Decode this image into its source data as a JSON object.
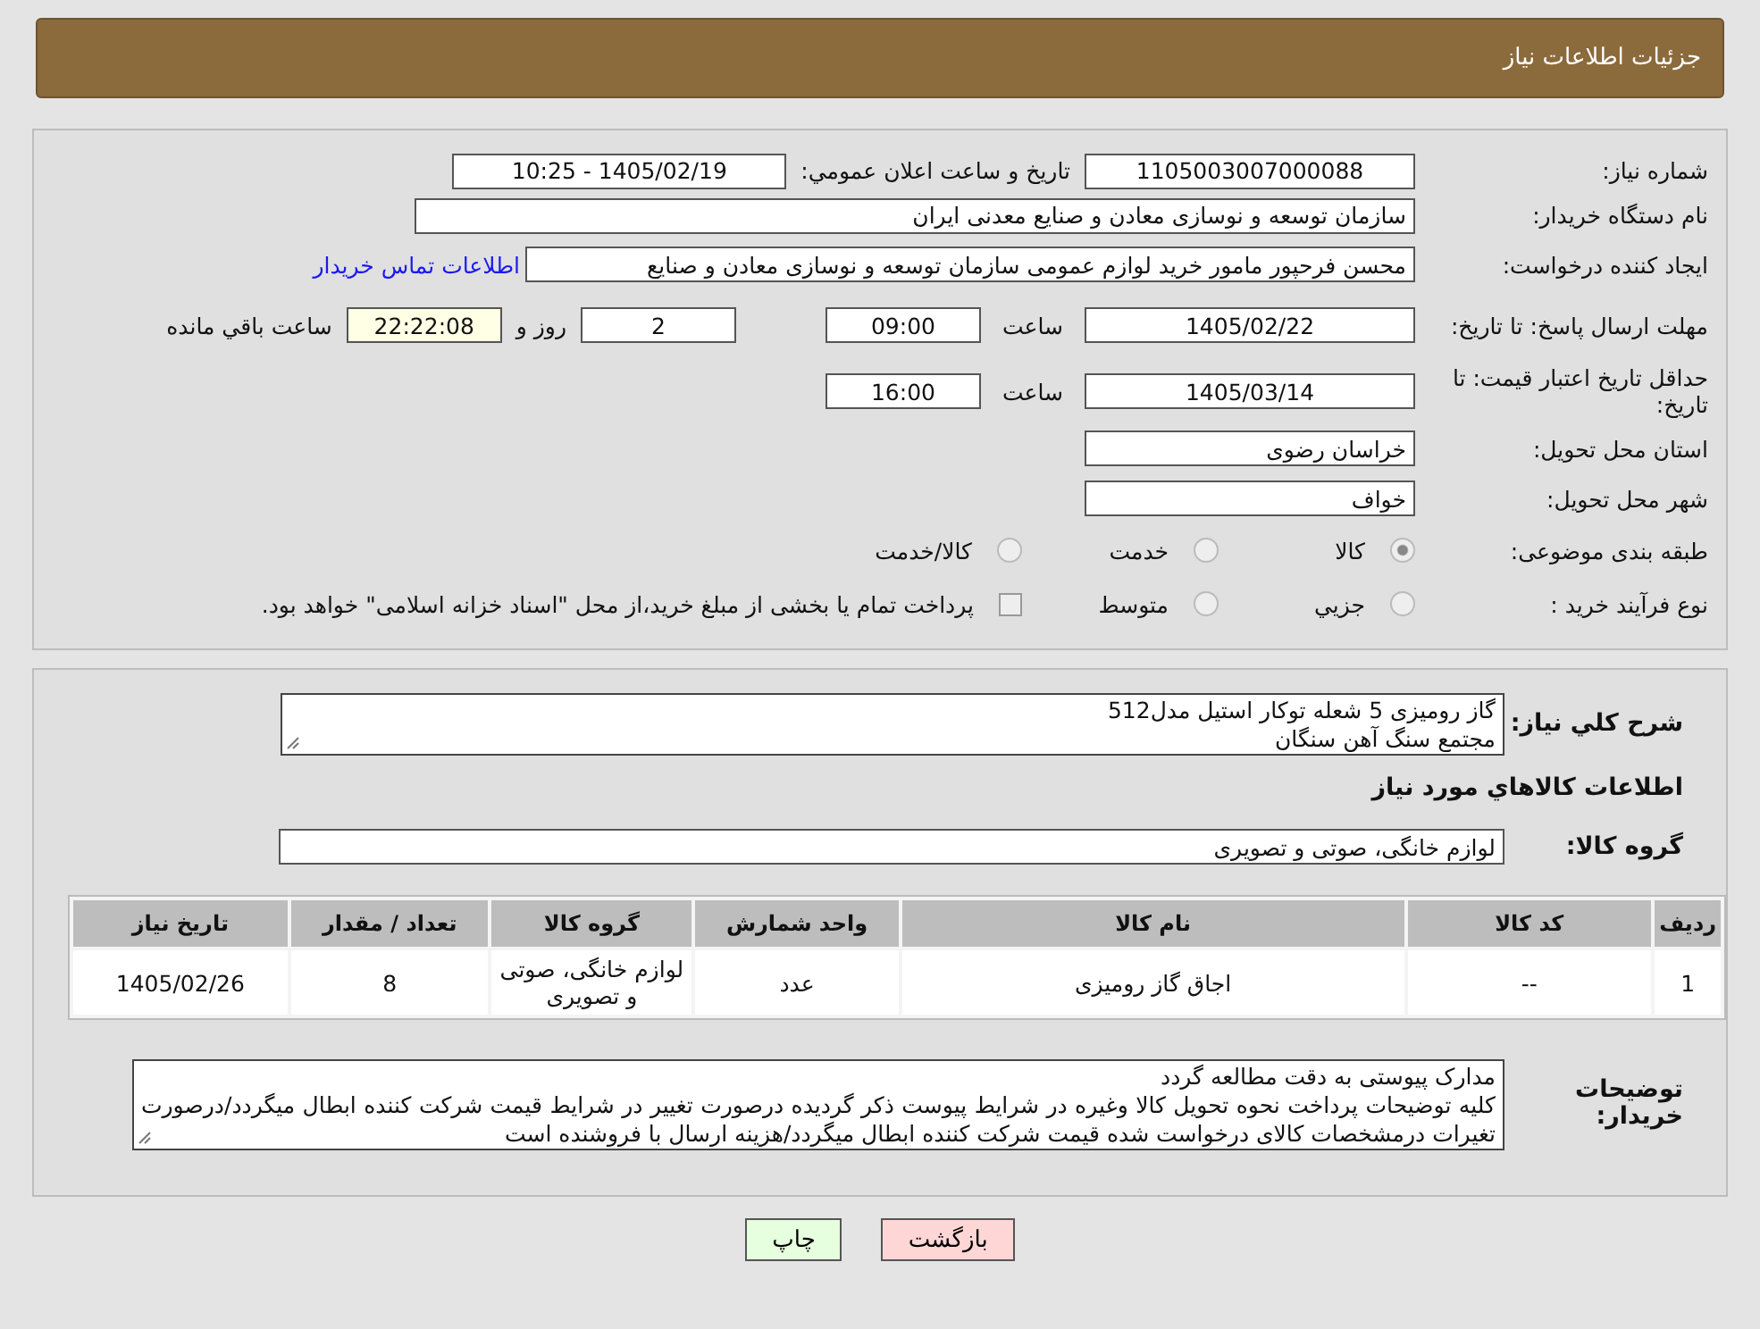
{
  "title": "جزئیات اطلاعات نیاز",
  "need_number": {
    "label": "شماره نیاز:",
    "value": "1105003007000088"
  },
  "announce": {
    "label": "تاريخ و ساعت اعلان عمومي:",
    "value": "1405/02/19 - 10:25"
  },
  "buyer_org": {
    "label": "نام دستگاه خريدار:",
    "value": "سازمان توسعه و نوسازی معادن و صنایع معدنی ایران"
  },
  "creator": {
    "label": "ايجاد کننده درخواست:",
    "value": "محسن فرحپور مامور خرید لوازم عمومی سازمان توسعه و نوسازی معادن و صنایع",
    "link": "اطلاعات تماس خريدار"
  },
  "deadline": {
    "label": "مهلت ارسال پاسخ: تا تاریخ:",
    "date": "1405/02/22",
    "time_label": "ساعت",
    "time": "09:00",
    "days": "2",
    "days_label": "روز و",
    "remaining": "22:22:08",
    "remaining_label": "ساعت باقي مانده"
  },
  "validity": {
    "label": "حداقل تاریخ اعتبار قیمت: تا تاریخ:",
    "date": "1405/03/14",
    "time_label": "ساعت",
    "time": "16:00"
  },
  "province": {
    "label": "استان محل تحویل:",
    "value": "خراسان رضوی"
  },
  "city": {
    "label": "شهر محل تحویل:",
    "value": "خواف"
  },
  "category": {
    "label": "طبقه بندی موضوعی:",
    "options": [
      {
        "label": "کالا",
        "selected": true
      },
      {
        "label": "خدمت",
        "selected": false
      },
      {
        "label": "کالا/خدمت",
        "selected": false
      }
    ]
  },
  "purchase_type": {
    "label": "نوع فرآیند خرید :",
    "options": [
      {
        "kind": "radio",
        "label": "جزيي",
        "selected": false
      },
      {
        "kind": "radio",
        "label": "متوسط",
        "selected": false
      },
      {
        "kind": "checkbox",
        "label": "پرداخت تمام یا بخشی از مبلغ خرید،از محل \"اسناد خزانه اسلامی\" خواهد بود.",
        "selected": false
      }
    ]
  },
  "description": {
    "label": "شرح کلي نياز:",
    "lines": [
      "گاز رومیزی 5 شعله توکار  استیل مدل512",
      "مجتمع سنگ آهن سنگان"
    ]
  },
  "goods_heading": "اطلاعات کالاهاي مورد نياز",
  "goods_group": {
    "label": "گروه کالا:",
    "value": "لوازم خانگی، صوتی و تصویری"
  },
  "table": {
    "columns": [
      "رديف",
      "کد کالا",
      "نام کالا",
      "واحد شمارش",
      "گروه کالا",
      "تعداد / مقدار",
      "تاريخ نياز"
    ],
    "rows": [
      [
        "1",
        "--",
        "اجاق گاز رومیزی",
        "عدد",
        "لوازم خانگی، صوتی و تصویری",
        "8",
        "1405/02/26"
      ]
    ]
  },
  "buyer_notes": {
    "label": "توضیحات خریدار:",
    "lines": [
      "مدارک پیوستی به دقت مطالعه گردد",
      "کلیه توضیحات پرداخت نحوه تحویل کالا وغیره در شرایط پیوست ذکر گردیده درصورت تغییر در شرایط  قیمت شرکت کننده ابطال میگردد/درصورت تغیرات درمشخصات کالای درخواست شده قیمت شرکت کننده ابطال میگردد/هزینه ارسال با فروشنده است"
    ]
  },
  "buttons": [
    {
      "kind": "back",
      "label": "بازگشت"
    },
    {
      "kind": "print",
      "label": "چاپ"
    }
  ]
}
